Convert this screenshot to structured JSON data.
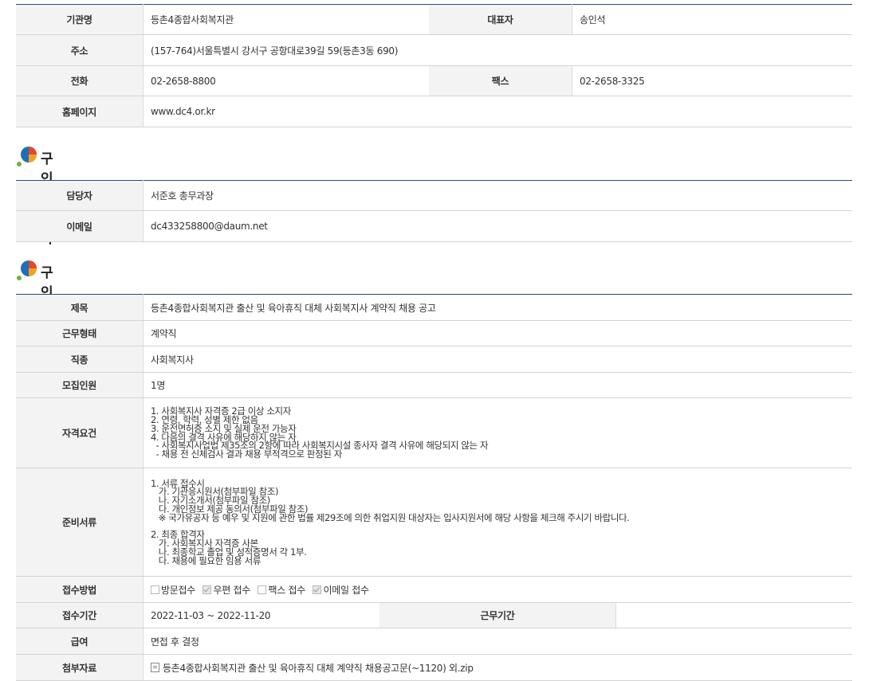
{
  "org_table": {
    "rows": [
      {
        "label": "기관명",
        "value": "등촌4종합사회복지관",
        "label2": "대표자",
        "value2": "송인석"
      },
      {
        "label": "주소",
        "value": "(157-764)서울특별시 강서구 공항대로39길 59(등촌3동 690)"
      },
      {
        "label": "전화",
        "value": "02-2658-8800",
        "label2": "팩스",
        "value2": "02-2658-3325"
      },
      {
        "label": "홈페이지",
        "value": "www.dc4.or.kr"
      }
    ]
  },
  "contact_section": {
    "title": "구인담당자",
    "rows": [
      {
        "label": "담당자",
        "value": "서준호 총무과장"
      },
      {
        "label": "이메일",
        "value": "dc433258800@daum.net"
      }
    ]
  },
  "job_section": {
    "title": "구인정보",
    "title_row": {
      "label": "제목",
      "value": "등촌4종합사회복지관 출산 및 육아휴직 대체 사회복지사 계약직 채용 공고"
    },
    "work_type": {
      "label": "근무형태",
      "value": "계약직"
    },
    "job_kind": {
      "label": "직종",
      "value": "사회복지사"
    },
    "headcount": {
      "label": "모집인원",
      "value": "1명"
    },
    "requirements": {
      "label": "자격요건",
      "lines": [
        "1. 사회복지사 자격증 2급 이상 소지자",
        "2. 연령, 학력, 성별 제한 없음",
        "3. 운전면허증 소지 및 실제 운전 가능자",
        "4. 다음의 결격 사유에 해당하지 않는 자",
        "  - 사회복지사업법 제35조의 2항에 따라 사회복지시설 종사자 결격 사유에 해당되지 않는 자",
        "  - 채용 전 신체검사 결과 채용 부적격으로 판정된 자"
      ]
    },
    "documents": {
      "label": "준비서류",
      "lines": [
        "1. 서류 접수시",
        "   가. 기관응시원서(첨부파일 참조)",
        "   나. 자기소개서(첨부파일 참조)",
        "   다. 개인정보 제공 동의서(첨부파일 참조)",
        "   ※ 국가유공자 등 예우 및 지원에 관한 법률 제29조에 의한 취업지원 대상자는 입사지원서에 해당 사항을 체크해 주시기 바랍니다.",
        "",
        "2. 최종 합격자",
        "   가. 사회복지사 자격증 사본",
        "   나. 최종학교 졸업 및 성적증명서 각 1부.",
        "   다. 채용에 필요한 임용 서류"
      ]
    },
    "method": {
      "label": "접수방법",
      "options": [
        {
          "text": "방문접수",
          "checked": false
        },
        {
          "text": "우편 접수",
          "checked": true
        },
        {
          "text": "팩스 접수",
          "checked": false
        },
        {
          "text": "이메일 접수",
          "checked": true
        }
      ]
    },
    "period": {
      "label": "접수기간",
      "value": "2022-11-03 ~ 2022-11-20",
      "label2": "근무기간",
      "value2": ""
    },
    "salary": {
      "label": "급여",
      "value": "면접 후 결정"
    },
    "attachment": {
      "label": "첨부자료",
      "value": "등촌4종합사회복지관 출산 및 육아휴직 대체 계약직 채용공고문(~1120) 외.zip"
    }
  },
  "colors": {
    "accent_line": "#2b4a78",
    "header_bg": "#f3f3f3",
    "border": "#d4d4d4"
  }
}
